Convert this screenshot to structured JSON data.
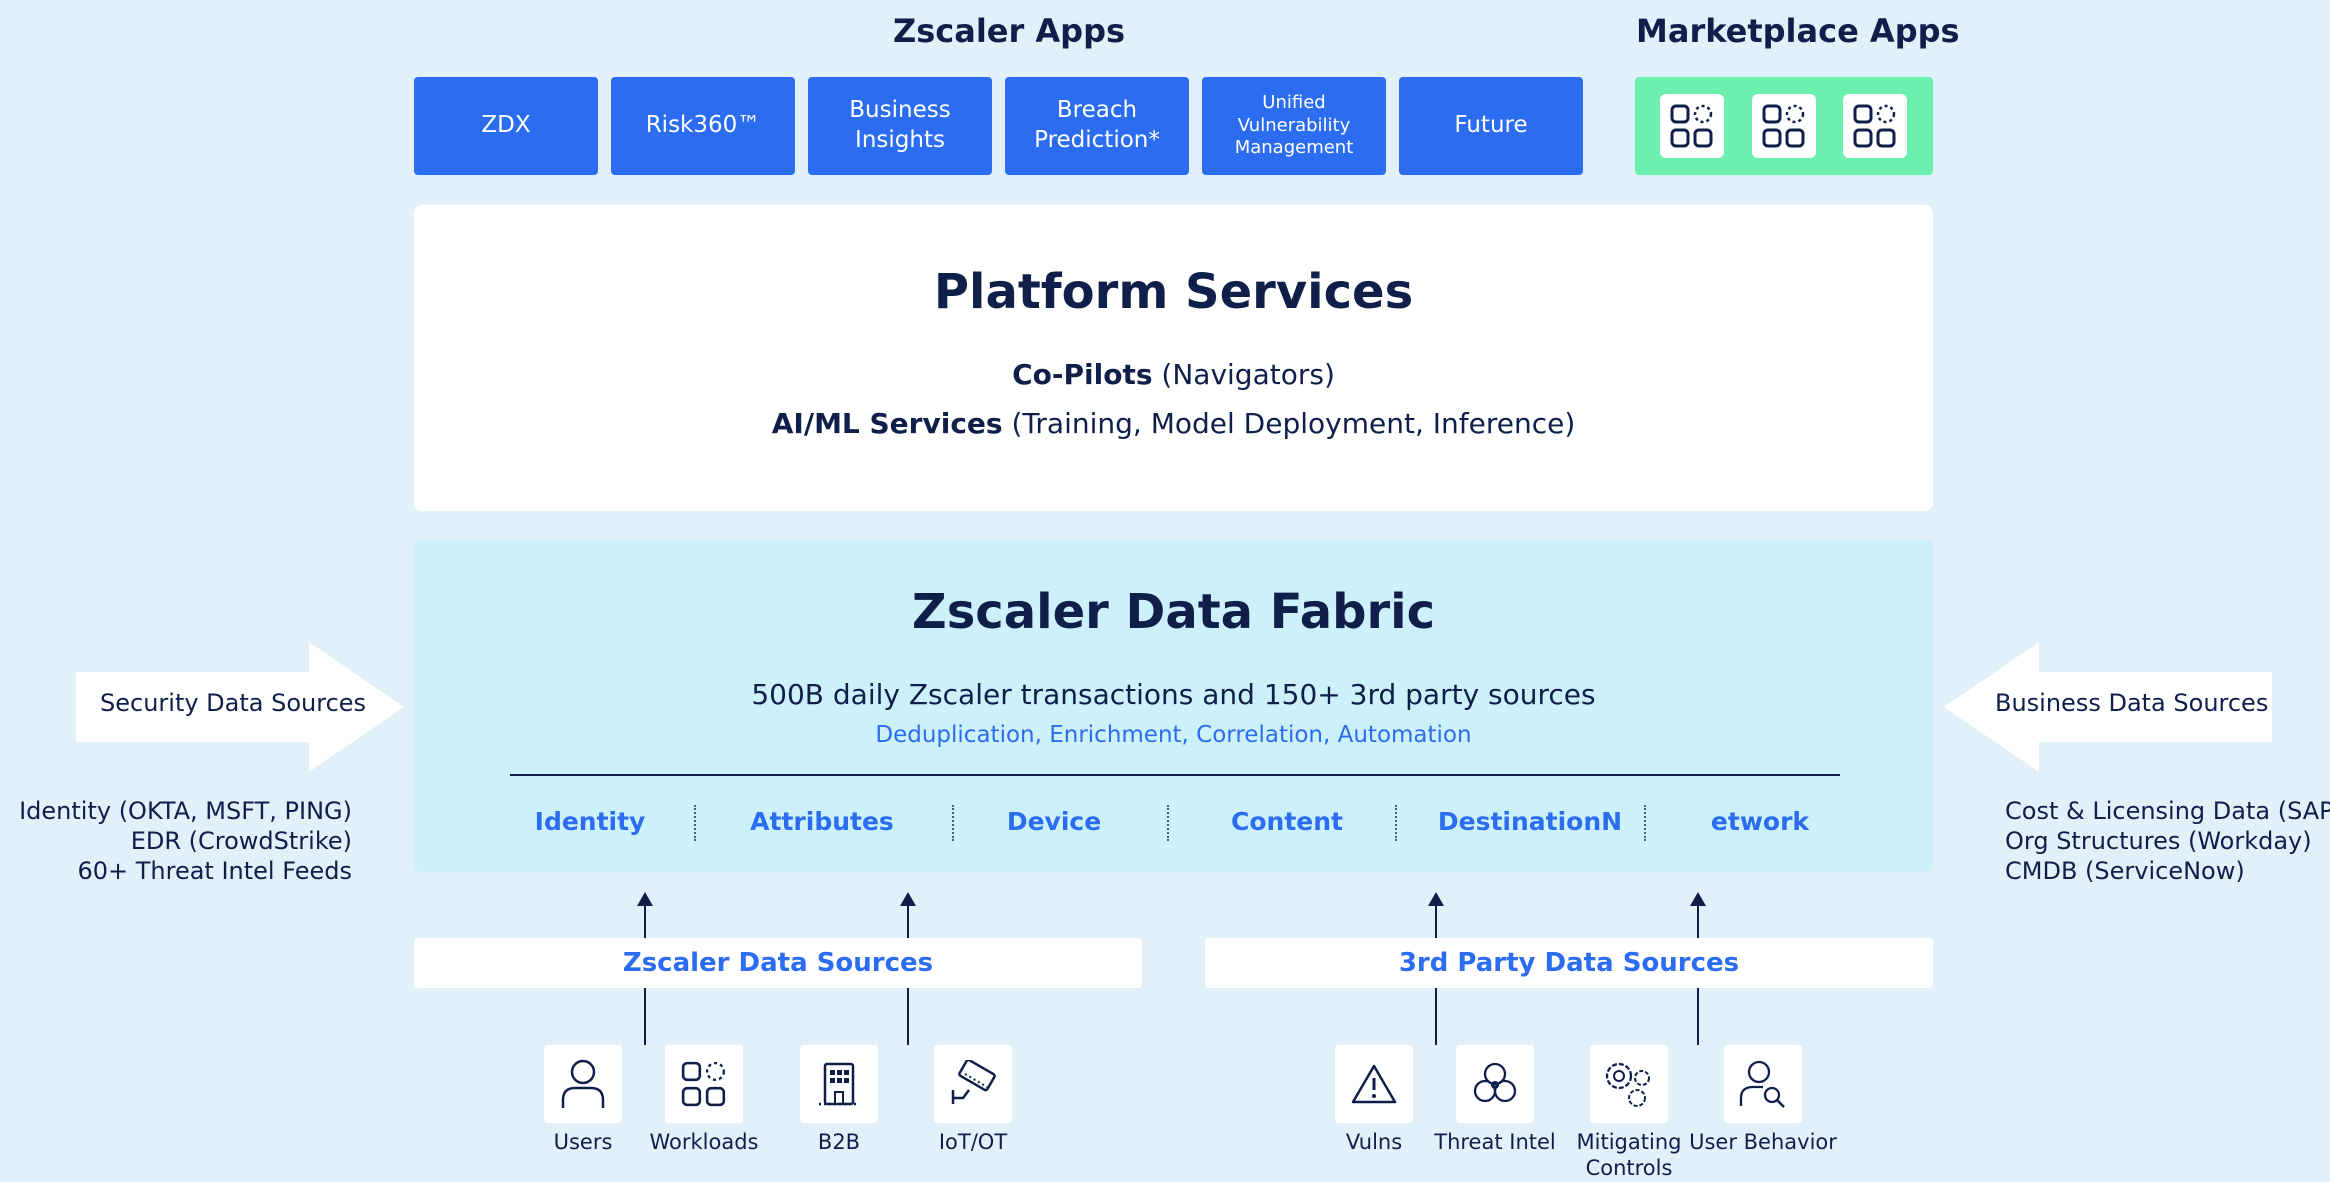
{
  "zscaler_apps": {
    "title": "Zscaler Apps",
    "tiles": [
      "ZDX",
      "Risk360™",
      "Business Insights",
      "Breach Prediction*",
      "Unified Vulnerability Management",
      "Future"
    ]
  },
  "marketplace_apps": {
    "title": "Marketplace Apps"
  },
  "platform_services": {
    "title": "Platform Services",
    "line1_bold": "Co-Pilots",
    "line1_rest": " (Navigators)",
    "line2_bold": "AI/ML Services",
    "line2_rest": " (Training, Model Deployment, Inference)"
  },
  "data_fabric": {
    "title": "Zscaler Data Fabric",
    "subtitle": "500B daily Zscaler transactions and 150+ 3rd party sources",
    "capabilities": "Deduplication, Enrichment, Correlation, Automation",
    "categories": [
      "Identity",
      "Attributes",
      "Device",
      "Content",
      "DestinationN",
      "etwork"
    ]
  },
  "security_sources": {
    "label": "Security Data Sources",
    "items": [
      "Identity (OKTA, MSFT, PING)",
      "EDR (CrowdStrike)",
      "60+ Threat Intel Feeds"
    ]
  },
  "business_sources": {
    "label": "Business Data Sources",
    "items": [
      "Cost & Licensing Data (SAP)",
      "Org Structures (Workday)",
      "CMDB (ServiceNow)"
    ]
  },
  "zscaler_data_sources": {
    "label": "Zscaler Data Sources",
    "items": [
      {
        "label": "Users",
        "icon": "user-icon"
      },
      {
        "label": "Workloads",
        "icon": "workloads-icon"
      },
      {
        "label": "B2B",
        "icon": "building-icon"
      },
      {
        "label": "IoT/OT",
        "icon": "camera-icon"
      }
    ]
  },
  "third_party_sources": {
    "label": "3rd Party Data Sources",
    "items": [
      {
        "label": "Vulns",
        "icon": "warning-icon"
      },
      {
        "label": "Threat Intel",
        "icon": "biohazard-icon"
      },
      {
        "label": "Mitigating Controls",
        "icon": "gears-icon"
      },
      {
        "label": "User Behavior",
        "icon": "user-search-icon"
      }
    ]
  },
  "colors": {
    "primary": "#2b6cf0",
    "marketplace": "#6cf0ad",
    "fabric": "#cdf1fa",
    "background": "#e2f0fa",
    "text": "#0f1f4a"
  }
}
